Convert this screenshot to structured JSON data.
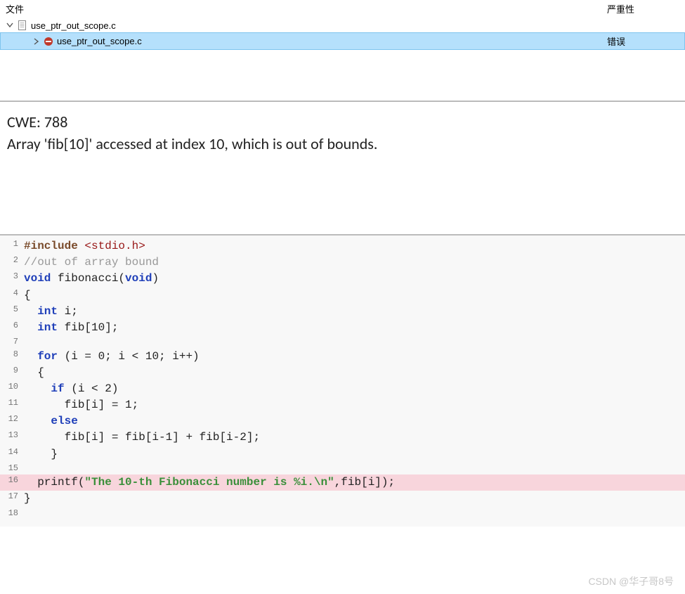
{
  "header": {
    "file_label": "文件",
    "severity_label": "严重性"
  },
  "tree": {
    "parent": {
      "name": "use_ptr_out_scope.c"
    },
    "child": {
      "name": "use_ptr_out_scope.c",
      "severity": "错误"
    }
  },
  "message": {
    "line1": "CWE: 788",
    "line2": "Array 'fib[10]' accessed at index 10, which is out of bounds."
  },
  "code": {
    "lines": [
      {
        "n": "1",
        "highlighted": false,
        "raw": "#include <stdio.h>"
      },
      {
        "n": "2",
        "highlighted": false,
        "raw": "//out of array bound"
      },
      {
        "n": "3",
        "highlighted": false,
        "raw": "void fibonacci(void)"
      },
      {
        "n": "4",
        "highlighted": false,
        "raw": "{"
      },
      {
        "n": "5",
        "highlighted": false,
        "raw": "  int i;"
      },
      {
        "n": "6",
        "highlighted": false,
        "raw": "  int fib[10];"
      },
      {
        "n": "7",
        "highlighted": false,
        "raw": ""
      },
      {
        "n": "8",
        "highlighted": false,
        "raw": "  for (i = 0; i < 10; i++)"
      },
      {
        "n": "9",
        "highlighted": false,
        "raw": "  {"
      },
      {
        "n": "10",
        "highlighted": false,
        "raw": "    if (i < 2)"
      },
      {
        "n": "11",
        "highlighted": false,
        "raw": "      fib[i] = 1;"
      },
      {
        "n": "12",
        "highlighted": false,
        "raw": "    else"
      },
      {
        "n": "13",
        "highlighted": false,
        "raw": "      fib[i] = fib[i-1] + fib[i-2];"
      },
      {
        "n": "14",
        "highlighted": false,
        "raw": "    }"
      },
      {
        "n": "15",
        "highlighted": false,
        "raw": ""
      },
      {
        "n": "16",
        "highlighted": true,
        "raw": "  printf(\"The 10-th Fibonacci number is %i.\\n\",fib[i]);"
      },
      {
        "n": "17",
        "highlighted": false,
        "raw": "}"
      },
      {
        "n": "18",
        "highlighted": false,
        "raw": ""
      }
    ]
  },
  "watermark": "CSDN @华子哥8号"
}
